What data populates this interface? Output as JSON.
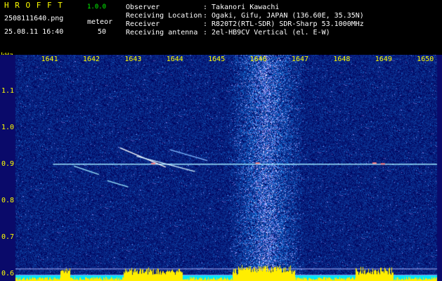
{
  "header": {
    "app_title": "H R O F F T",
    "version": "1.0.0",
    "filename": "2508111640.png",
    "meteor_label": "meteor",
    "datetime": "25.08.11 16:40",
    "meteor_count": "50",
    "fields": [
      {
        "label": "Observer",
        "value": ": Takanori Kawachi"
      },
      {
        "label": "Receiving Location",
        "value": ": Ogaki, Gifu, JAPAN (136.60E, 35.35N)"
      },
      {
        "label": "Receiver",
        "value": ": R820T2(RTL-SDR) SDR-Sharp 53.1000MHz"
      },
      {
        "label": "Receiving antenna",
        "value": ": 2el-HB9CV Vertical (el. E-W)"
      }
    ]
  },
  "spectrogram": {
    "y_unit": "kHz",
    "x_ticks": [
      "1641",
      "1642",
      "1643",
      "1644",
      "1645",
      "1646",
      "1647",
      "1648",
      "1649",
      "1650"
    ],
    "x_range": [
      1640.2,
      1650.3
    ],
    "y_ticks": [
      "1.1",
      "1.0",
      "0.9",
      "0.8",
      "0.7",
      "0.6"
    ],
    "y_range": [
      0.58,
      1.2
    ],
    "carrier_freq_khz": 0.9,
    "colors": {
      "background": "#0a0a6a",
      "noise": "#2f6bff",
      "carrier": "#9fe8ff",
      "level": "#ffee00",
      "cyan_band": "#00e5ff"
    }
  }
}
